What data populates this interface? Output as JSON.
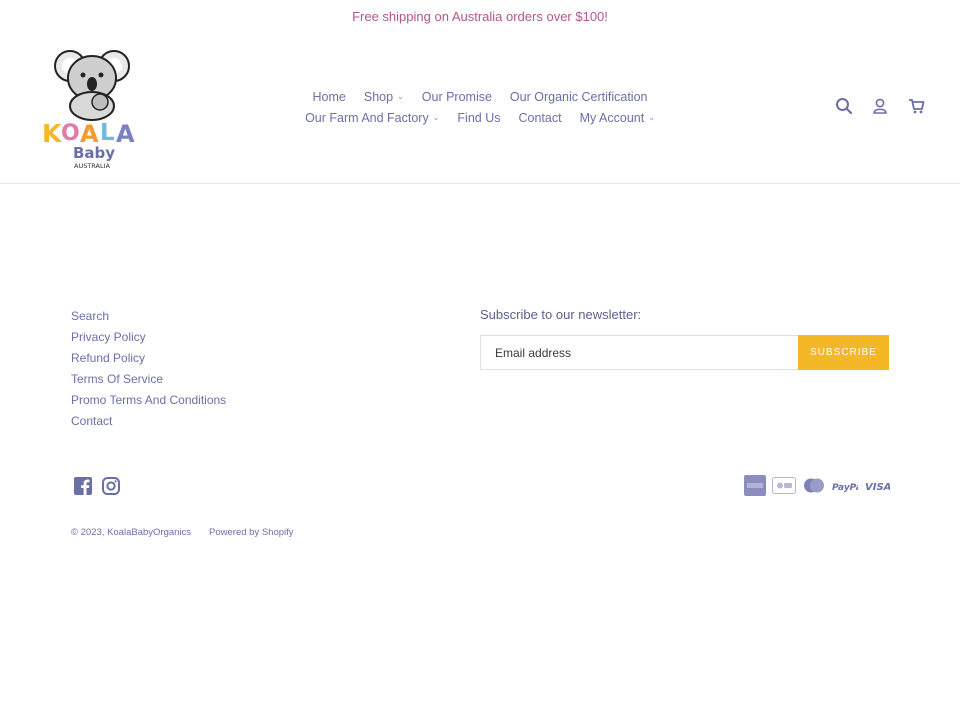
{
  "announcement": "Free shipping on Australia orders over $100!",
  "logo": {
    "brand_top": "KOALA",
    "brand_mid": "Baby",
    "brand_bottom": "AUSTRALIA"
  },
  "nav": {
    "row1": [
      {
        "label": "Home"
      },
      {
        "label": "Shop",
        "caret": "⌄"
      },
      {
        "label": "Our Promise"
      },
      {
        "label": "Our Organic Certification"
      }
    ],
    "row2": [
      {
        "label": "Our Farm And Factory",
        "caret": "⌄"
      },
      {
        "label": "Find Us"
      },
      {
        "label": "Contact"
      },
      {
        "label": "My Account",
        "caret": "⌄"
      }
    ]
  },
  "header_icons": [
    "search-icon",
    "account-icon",
    "cart-icon"
  ],
  "footer_links": [
    "Search",
    "Privacy Policy",
    "Refund Policy",
    "Terms Of Service",
    "Promo Terms And Conditions",
    "Contact"
  ],
  "newsletter": {
    "title": "Subscribe to our newsletter:",
    "placeholder": "Email address",
    "button": "SUBSCRIBE"
  },
  "social": [
    "facebook-icon",
    "instagram-icon"
  ],
  "payments": [
    "American Express",
    "Apple Pay",
    "Mastercard",
    "PayPal",
    "VISA"
  ],
  "copyright": {
    "prefix": "© 2023,",
    "store": "KoalaBabyOrganics",
    "powered": "Powered by Shopify"
  },
  "colors": {
    "link": "#6b6fa8",
    "announcement": "#b3568f",
    "subscribe": "#f4b728"
  }
}
